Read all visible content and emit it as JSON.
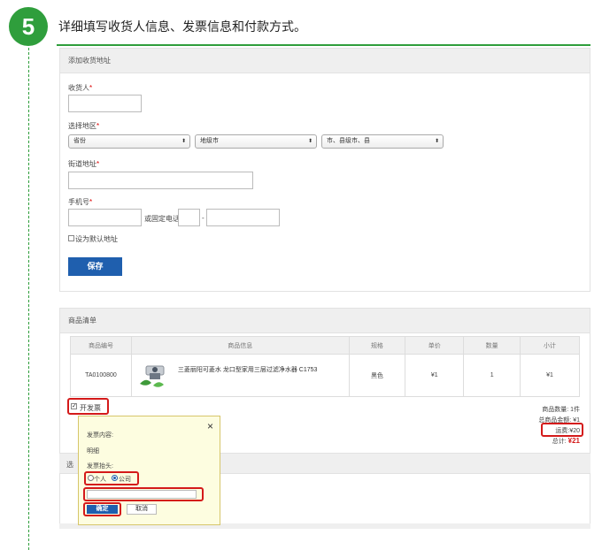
{
  "step": {
    "number": "5",
    "text": "详细填写收货人信息、发票信息和付款方式。"
  },
  "address": {
    "title": "添加收货地址",
    "receiver_label": "收货人",
    "region_label": "选择地区",
    "province": "省份",
    "city": "地级市",
    "county": "市、县级市、县",
    "street_label": "街道地址",
    "phone_label": "手机号",
    "landline_label": "或固定电话",
    "dash": "-",
    "required_mark": "*",
    "default_label": "设为默认地址",
    "save_label": "保存"
  },
  "goods": {
    "title": "商品清单",
    "headers": [
      "商品编号",
      "商品信息",
      "规格",
      "单价",
      "数量",
      "小计"
    ],
    "row": {
      "code": "TA0100800",
      "name": "三菱丽阳可菱水 龙口型家用三层过滤净水器 C1753",
      "spec": "黑色",
      "price": "¥1",
      "qty": "1",
      "subtotal": "¥1"
    }
  },
  "invoice": {
    "toggle_label": "开发票",
    "content_label": "发票内容:",
    "content_value": "明细",
    "header_label": "发票抬头:",
    "personal_label": "个人",
    "company_label": "公司",
    "confirm_label": "确定",
    "cancel_label": "取消",
    "close_glyph": "×"
  },
  "summary": {
    "count": "商品数量: 1件",
    "amount": "总商品金额: ¥1",
    "shipping_label": "运费:",
    "shipping_value": "¥20",
    "total_label": "总计:",
    "total_value": "¥21"
  },
  "payment": {
    "title_partial": "选"
  },
  "colors": {
    "accent_green": "#2f9e3c",
    "button_blue": "#1f5fae",
    "highlight_red": "#d41a1a"
  }
}
